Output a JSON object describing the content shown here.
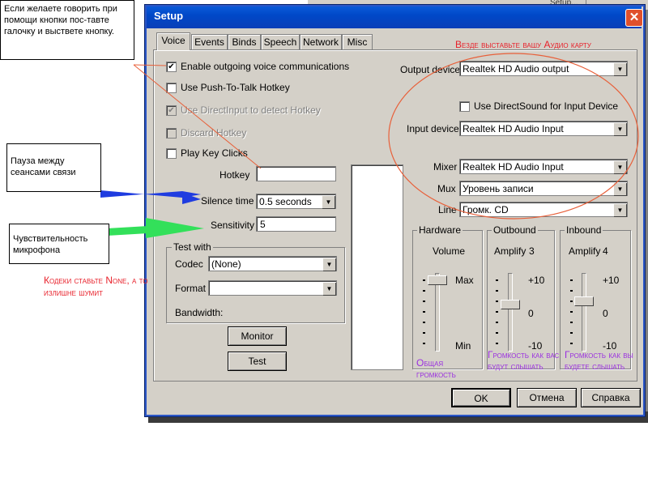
{
  "background_app": {
    "items": [
      "Setup..."
    ]
  },
  "dialog": {
    "title": "Setup",
    "close_glyph": "✕",
    "tabs": [
      {
        "label": "Voice",
        "active": true
      },
      {
        "label": "Events"
      },
      {
        "label": "Binds"
      },
      {
        "label": "Speech"
      },
      {
        "label": "Network"
      },
      {
        "label": "Misc"
      }
    ],
    "voice": {
      "checkboxes": [
        {
          "label": "Enable outgoing voice communications",
          "checked": true,
          "enabled": true
        },
        {
          "label": "Use Push-To-Talk Hotkey",
          "checked": false,
          "enabled": true
        },
        {
          "label": "Use DirectInput to detect Hotkey",
          "checked": true,
          "enabled": false
        },
        {
          "label": "Discard Hotkey",
          "checked": false,
          "enabled": false
        },
        {
          "label": "Play Key Clicks",
          "checked": false,
          "enabled": true
        }
      ],
      "check_glyph": "✔",
      "hotkey": {
        "label": "Hotkey",
        "value": ""
      },
      "silence_time": {
        "label": "Silence time",
        "value": "0.5 seconds"
      },
      "sensitivity": {
        "label": "Sensitivity",
        "value": "5"
      },
      "test_with": {
        "title": "Test with",
        "codec": {
          "label": "Codec",
          "value": "(None)"
        },
        "format": {
          "label": "Format",
          "value": ""
        },
        "bandwidth_label": "Bandwidth:"
      },
      "monitor_button": "Monitor",
      "test_button": "Test",
      "output_device": {
        "label": "Output device",
        "value": "Realtek HD Audio output"
      },
      "use_directsound": {
        "label": "Use DirectSound for Input Device",
        "checked": false
      },
      "input_device": {
        "label": "Input device",
        "value": "Realtek HD Audio Input"
      },
      "mixer": {
        "label": "Mixer",
        "value": "Realtek HD Audio Input"
      },
      "mux": {
        "label": "Mux",
        "value": "Уровень записи"
      },
      "line": {
        "label": "Line",
        "value": "Громк. CD"
      },
      "hardware": {
        "title": "Hardware",
        "volume_label": "Volume",
        "max_label": "Max",
        "min_label": "Min",
        "level": 1.0
      },
      "outbound": {
        "title": "Outbound",
        "amplify_label": "Amplify",
        "amplify_value": "3",
        "top": "+10",
        "mid": "0",
        "bottom": "-10",
        "level": 0.65
      },
      "inbound": {
        "title": "Inbound",
        "amplify_label": "Amplify",
        "amplify_value": "4",
        "top": "+10",
        "mid": "0",
        "bottom": "-10",
        "level": 0.7
      }
    },
    "buttons": {
      "ok": "OK",
      "cancel": "Отмена",
      "help": "Справка"
    },
    "arrow_glyph": "▼"
  },
  "annotations": {
    "ptt_note": "Если  желаете говорить при помощи кнопки пос-тавте галочку и выствете кнопку.",
    "pause_note": "Пауза между сеансами связи",
    "sensitivity_note": "Чувствительность микрофона",
    "codec_note": "Кодеки ставьте None, а то излишне шумит",
    "audio_card_note": "Везде выставьте вашу Аудио карту",
    "general_volume_note": "Общая громкость",
    "outbound_note": "Громкость как вас будут слышать",
    "inbound_note": "Громкость как вы будете слышать",
    "colors": {
      "red": "#e8202a",
      "purple": "#9a2fe0",
      "blue_arrow": "#1f3ce0",
      "green_arrow": "#33e05a",
      "ellipse": "#e8603a"
    }
  }
}
